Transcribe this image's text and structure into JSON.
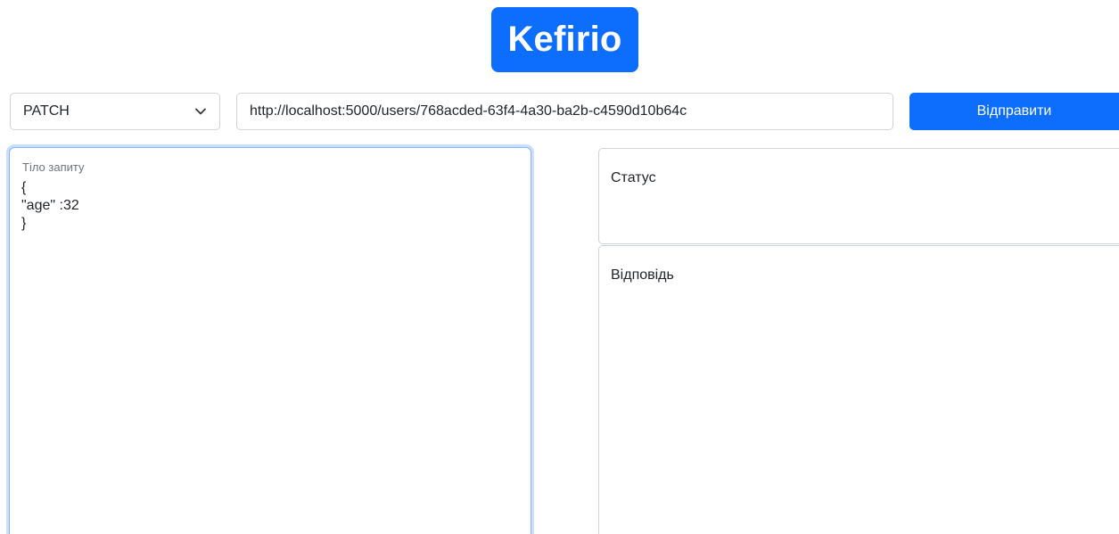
{
  "app": {
    "logo_text": "Kefirio",
    "accent_color": "#0d6efd"
  },
  "request": {
    "method": {
      "selected": "PATCH",
      "icon": "chevron-down-icon"
    },
    "url": "http://localhost:5000/users/768acded-63f4-4a30-ba2b-c4590d10b64c",
    "send_label": "Відправити",
    "body_label": "Тіло запиту",
    "body_value": "{\n\"age\" :32\n}"
  },
  "result": {
    "status_label": "Статус",
    "response_label": "Відповідь"
  }
}
